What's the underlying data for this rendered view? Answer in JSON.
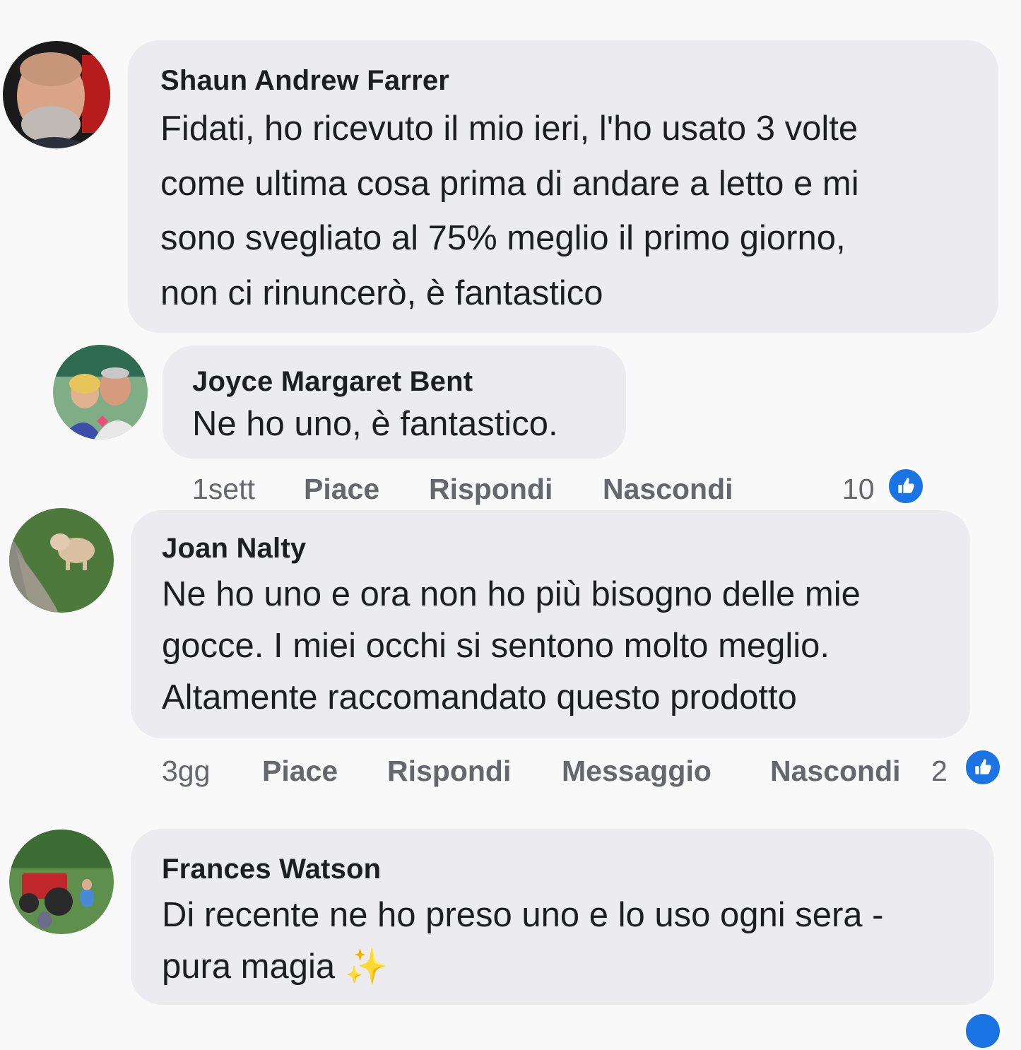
{
  "colors": {
    "bubble": "#ececf0",
    "background": "#f9f9f9",
    "meta_text": "#65676b",
    "like_blue": "#1b74e4",
    "sparkle": "#f5c531"
  },
  "comments": [
    {
      "author": "Shaun Andrew Farrer",
      "lines": [
        "Fidati, ho ricevuto il mio ieri, l'ho usato 3 volte",
        "come ultima cosa prima di andare a letto e mi",
        "sono svegliato al 75% meglio il primo giorno,",
        "non ci rinuncerò, è fantastico"
      ],
      "avatar_icon": "avatar-photo-man"
    },
    {
      "author": "Joyce Margaret Bent",
      "lines": [
        "Ne ho uno, è fantastico."
      ],
      "avatar_icon": "avatar-photo-couple",
      "meta": {
        "time": "1sett",
        "like": "Piace",
        "reply": "Rispondi",
        "hide": "Nascondi",
        "reaction_count": "10"
      }
    },
    {
      "author": "Joan Nalty",
      "lines": [
        "Ne ho uno e ora non ho più bisogno delle mie",
        "gocce. I miei occhi si sentono molto meglio.",
        "Altamente raccomandato questo prodotto"
      ],
      "avatar_icon": "avatar-photo-dog",
      "meta": {
        "time": "3gg",
        "like": "Piace",
        "reply": "Rispondi",
        "message": "Messaggio",
        "hide": "Nascondi",
        "reaction_count": "2"
      }
    },
    {
      "author": "Frances Watson",
      "lines": [
        "Di recente ne ho preso uno e lo uso ogni sera -",
        "pura magia"
      ],
      "emoji": "✨",
      "avatar_icon": "avatar-photo-tractor"
    }
  ]
}
